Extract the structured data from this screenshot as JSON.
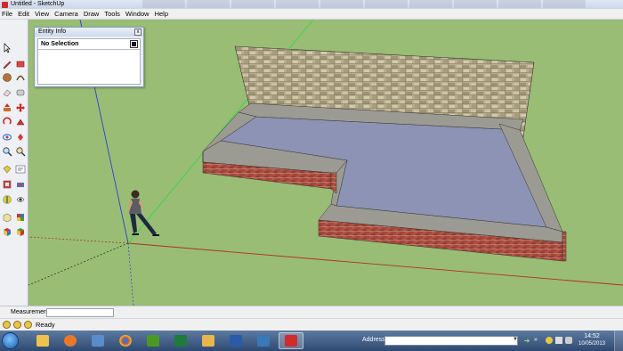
{
  "window": {
    "title": "Untitled - SketchUp"
  },
  "menu": [
    "File",
    "Edit",
    "View",
    "Camera",
    "Draw",
    "Tools",
    "Window",
    "Help"
  ],
  "entity_info": {
    "title": "Entity Info",
    "close_glyph": "x",
    "selection": "No Selection"
  },
  "measurements": {
    "label": "Measurements",
    "value": ""
  },
  "status": {
    "text": "Ready"
  },
  "taskbar": {
    "address_label": "Address",
    "address_value": "",
    "clock": {
      "time": "14:52",
      "date": "10/05/2013"
    },
    "apps": [
      {
        "name": "start-orb",
        "color": "#1b5aa8"
      },
      {
        "name": "windows-explorer-icon",
        "color": "#f0c24a"
      },
      {
        "name": "media-player-icon",
        "color": "#e8782a"
      },
      {
        "name": "sketch-app-icon",
        "color": "#5a8ccc"
      },
      {
        "name": "chrome-icon",
        "color": "#d23f31"
      },
      {
        "name": "dreamweaver-icon",
        "color": "#4a9a22"
      },
      {
        "name": "excel-icon",
        "color": "#1e7b3a"
      },
      {
        "name": "folder-icon",
        "color": "#e8b64a"
      },
      {
        "name": "word-icon",
        "color": "#2b5aa8"
      },
      {
        "name": "image-viewer-icon",
        "color": "#3a79b8"
      },
      {
        "name": "sketchup-icon",
        "color": "#d12b2b"
      }
    ]
  },
  "colors": {
    "viewport_bg": "#99bd74",
    "floor": "#8d93b4",
    "coping": "#9b9b93",
    "brick": "#a1473c",
    "stone": "#b9ad8c"
  }
}
